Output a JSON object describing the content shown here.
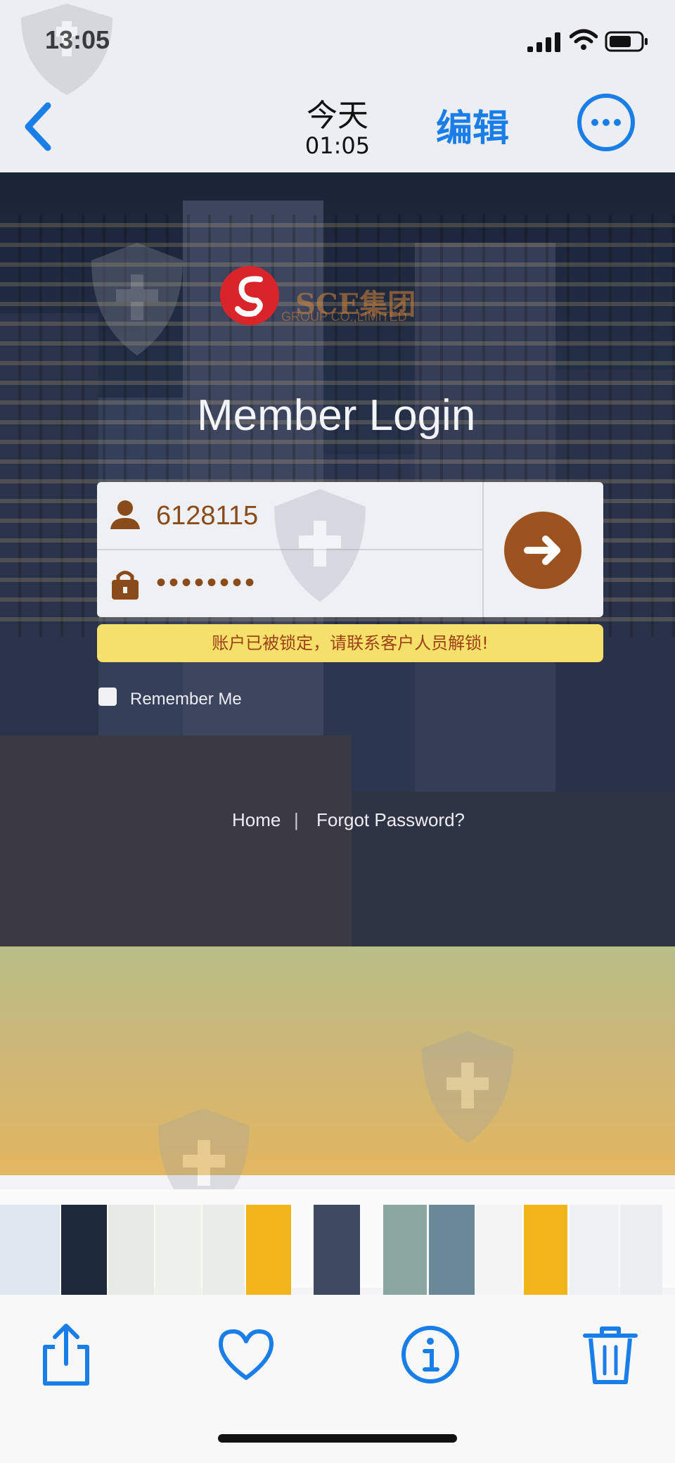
{
  "status_bar": {
    "time": "13:05"
  },
  "nav": {
    "title": "今天",
    "subtitle": "01:05",
    "edit_label": "编辑"
  },
  "login": {
    "title": "Member Login",
    "logo_text": "SCE集团",
    "logo_subtext": "GROUP CO.,LIMITED",
    "username": "6128115",
    "password_mask": "••••••••",
    "alert": "账户已被锁定，请联系客户人员解锁!",
    "remember_label": "Remember Me",
    "home_link": "Home",
    "separator": "|",
    "forgot_link": "Forgot Password?"
  },
  "colors": {
    "accent": "#1a7ee8",
    "brown": "#8a4b1b",
    "alert_bg": "#f5e16a",
    "alert_text": "#a0401a"
  },
  "toolbar": {
    "icons": [
      "share-icon",
      "heart-icon",
      "info-icon",
      "trash-icon"
    ]
  }
}
